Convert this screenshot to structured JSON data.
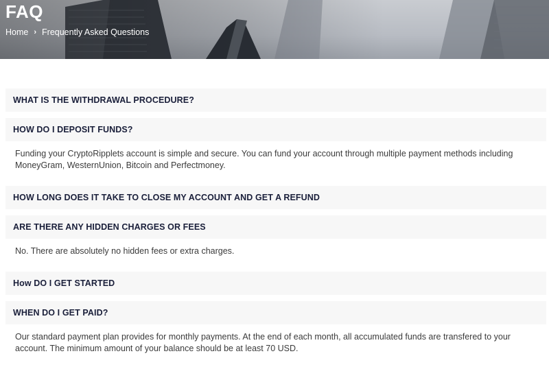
{
  "hero": {
    "title": "FAQ",
    "breadcrumb": {
      "home": "Home",
      "separator_icon": "chevron-right-icon",
      "current": "Frequently Asked Questions"
    }
  },
  "faq": [
    {
      "question": "WHAT IS THE WITHDRAWAL PROCEDURE?",
      "answer": ""
    },
    {
      "question": "HOW DO I DEPOSIT FUNDS?",
      "answer": "Funding your CryptoRipplets account is simple and secure. You can fund your account through multiple payment methods including MoneyGram, WesternUnion, Bitcoin and Perfectmoney."
    },
    {
      "question": "HOW LONG DOES IT TAKE TO CLOSE MY ACCOUNT AND GET A REFUND",
      "answer": ""
    },
    {
      "question": "ARE THERE ANY HIDDEN CHARGES OR FEES",
      "answer": "No. There are absolutely no hidden fees or extra charges."
    },
    {
      "question": "How DO I GET STARTED",
      "answer": ""
    },
    {
      "question": "WHEN DO I GET PAID?",
      "answer": "Our standard payment plan provides for monthly payments. At the end of each month, all accumulated funds are transfered to your account. The minimum amount of your balance should be at least 70 USD."
    }
  ]
}
